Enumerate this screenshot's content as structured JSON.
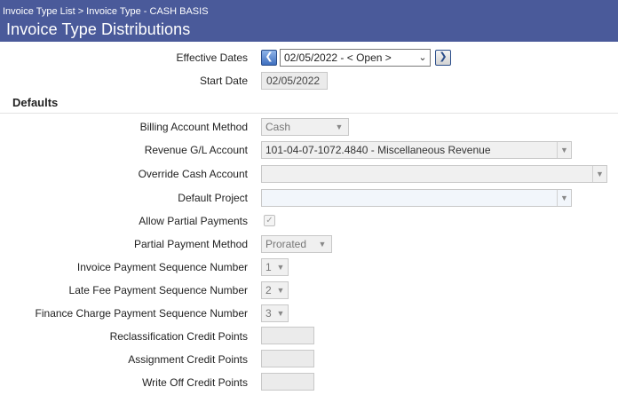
{
  "header": {
    "breadcrumb": [
      "Invoice Type List",
      "Invoice Type - CASH BASIS"
    ],
    "breadcrumb_separator": ">",
    "title": "Invoice Type Distributions",
    "background_color": "#4a5a9a"
  },
  "effective_dates": {
    "label": "Effective Dates",
    "value": "02/05/2022 - < Open >",
    "prev_icon": "chevron-left-icon",
    "next_icon": "chevron-right-icon"
  },
  "start_date": {
    "label": "Start Date",
    "value": "02/05/2022"
  },
  "defaults": {
    "section_title": "Defaults",
    "billing_account_method": {
      "label": "Billing Account Method",
      "value": "Cash"
    },
    "revenue_gl_account": {
      "label": "Revenue G/L Account",
      "value": "101-04-07-1072.4840 - Miscellaneous Revenue"
    },
    "override_cash_account": {
      "label": "Override Cash Account",
      "value": ""
    },
    "default_project": {
      "label": "Default Project",
      "value": ""
    },
    "allow_partial_payments": {
      "label": "Allow Partial Payments",
      "checked": true
    },
    "partial_payment_method": {
      "label": "Partial Payment Method",
      "value": "Prorated"
    },
    "invoice_payment_sequence": {
      "label": "Invoice Payment Sequence Number",
      "value": "1"
    },
    "late_fee_payment_sequence": {
      "label": "Late Fee Payment Sequence Number",
      "value": "2"
    },
    "finance_charge_payment_sequence": {
      "label": "Finance Charge Payment Sequence Number",
      "value": "3"
    },
    "reclassification_credit_points": {
      "label": "Reclassification Credit Points",
      "value": ""
    },
    "assignment_credit_points": {
      "label": "Assignment Credit Points",
      "value": ""
    },
    "write_off_credit_points": {
      "label": "Write Off Credit Points",
      "value": ""
    }
  }
}
